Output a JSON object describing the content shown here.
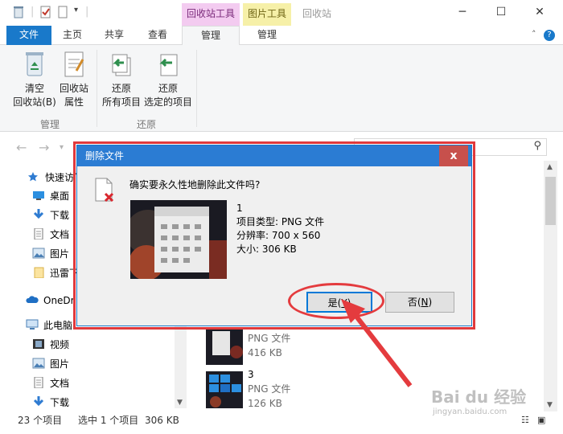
{
  "window": {
    "title": "回收站",
    "context_tabs": {
      "recycle_tools": "回收站工具",
      "picture_tools": "图片工具"
    },
    "controls": {
      "minimize": "─",
      "maximize": "☐",
      "close": "✕"
    }
  },
  "ribbon": {
    "tabs": [
      "文件",
      "主页",
      "共享",
      "查看",
      "管理",
      "管理"
    ],
    "active_tab_index": 4,
    "groups": [
      {
        "label": "管理",
        "buttons": [
          {
            "line1": "清空",
            "line2": "回收站(B)",
            "icon": "recycle-bin-icon"
          },
          {
            "line1": "回收站",
            "line2": "属性",
            "icon": "properties-icon"
          }
        ]
      },
      {
        "label": "还原",
        "buttons": [
          {
            "line1": "还原",
            "line2": "所有项目",
            "icon": "restore-all-icon"
          },
          {
            "line1": "还原",
            "line2": "选定的项目",
            "icon": "restore-selected-icon"
          }
        ]
      }
    ]
  },
  "sidebar": {
    "items": [
      {
        "label": "快速访问",
        "icon": "star-icon"
      },
      {
        "label": "桌面",
        "icon": "desktop-icon"
      },
      {
        "label": "下载",
        "icon": "download-icon"
      },
      {
        "label": "文档",
        "icon": "document-icon"
      },
      {
        "label": "图片",
        "icon": "picture-icon"
      },
      {
        "label": "迅雷下",
        "icon": "folder-icon"
      },
      {
        "label": "OneDr",
        "icon": "cloud-icon"
      },
      {
        "label": "此电脑",
        "icon": "computer-icon"
      },
      {
        "label": "视频",
        "icon": "video-icon"
      },
      {
        "label": "图片",
        "icon": "picture-icon"
      },
      {
        "label": "文档",
        "icon": "document-icon"
      },
      {
        "label": "下载",
        "icon": "download-icon"
      }
    ]
  },
  "files": [
    {
      "name": "",
      "type": "PNG 文件",
      "size": "416 KB"
    },
    {
      "name": "3",
      "type": "PNG 文件",
      "size": "126 KB"
    }
  ],
  "status": {
    "count": "23 个项目",
    "selection": "选中 1 个项目",
    "size": "306 KB"
  },
  "dialog": {
    "title": "删除文件",
    "close": "x",
    "question": "确实要永久性地删除此文件吗?",
    "file_name": "1",
    "type_line": "项目类型: PNG 文件",
    "resolution_line": "分辨率: 700 x 560",
    "size_line": "大小: 306 KB",
    "yes_text": "是(",
    "yes_key": "Y",
    "yes_close": ")",
    "no_text": "否(",
    "no_key": "N",
    "no_close": ")"
  },
  "watermark": {
    "logo": "Bai du 经验",
    "url": "jingyan.baidu.com"
  },
  "colors": {
    "accent": "#1979ca",
    "highlight_red": "#e0393c",
    "dialog_title": "#2b7cd3"
  }
}
